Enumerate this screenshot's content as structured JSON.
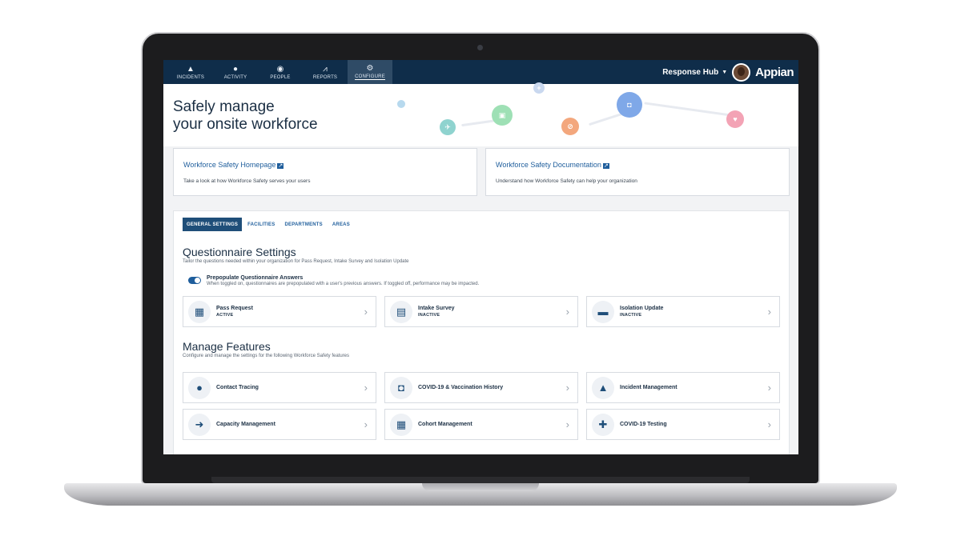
{
  "nav": {
    "tabs": [
      {
        "label": "INCIDENTS",
        "icon": "warning-icon"
      },
      {
        "label": "ACTIVITY",
        "icon": "chat-icon"
      },
      {
        "label": "PEOPLE",
        "icon": "person-icon"
      },
      {
        "label": "REPORTS",
        "icon": "chart-icon"
      },
      {
        "label": "CONFIGURE",
        "icon": "gear-icon"
      }
    ],
    "active_tab": "CONFIGURE",
    "site_name": "Response Hub",
    "logo": "Appian"
  },
  "hero": {
    "title_line1": "Safely manage",
    "title_line2": "your onsite workforce"
  },
  "links": [
    {
      "title": "Workforce Safety Homepage",
      "desc": "Take a look at how Workforce Safety serves your users"
    },
    {
      "title": "Workforce Safety Documentation",
      "desc": "Understand how Workforce Safety can help your organization"
    }
  ],
  "settings_tabs": [
    "GENERAL SETTINGS",
    "FACILITIES",
    "DEPARTMENTS",
    "AREAS"
  ],
  "questionnaire": {
    "title": "Questionnaire Settings",
    "desc": "Tailor the questions needed within your organization for Pass Request, Intake Survey and Isolation Update",
    "toggle_label": "Prepopulate Questionnaire Answers",
    "toggle_help": "When toggled on, questionnaires are prepopulated with a user's previous answers. If toggled off, performance may be impacted.",
    "toggle_on": true,
    "items": [
      {
        "label": "Pass Request",
        "status": "ACTIVE",
        "icon": "qr-code-icon"
      },
      {
        "label": "Intake Survey",
        "status": "INACTIVE",
        "icon": "document-icon"
      },
      {
        "label": "Isolation Update",
        "status": "INACTIVE",
        "icon": "bed-icon"
      }
    ]
  },
  "features": {
    "title": "Manage Features",
    "desc": "Configure and manage the settings for the following Workforce Safety features",
    "items": [
      {
        "label": "Contact Tracing",
        "icon": "chat-bubbles-icon"
      },
      {
        "label": "COVID-19 & Vaccination History",
        "icon": "shield-icon"
      },
      {
        "label": "Incident Management",
        "icon": "warning-icon"
      },
      {
        "label": "Capacity Management",
        "icon": "sign-in-icon"
      },
      {
        "label": "Cohort Management",
        "icon": "grid-icon"
      },
      {
        "label": "COVID-19 Testing",
        "icon": "medical-kit-icon"
      }
    ]
  },
  "colors": {
    "nav_bg": "#0f2d4a",
    "accent": "#1f5e9c",
    "active_tab": "#1f4e79"
  }
}
